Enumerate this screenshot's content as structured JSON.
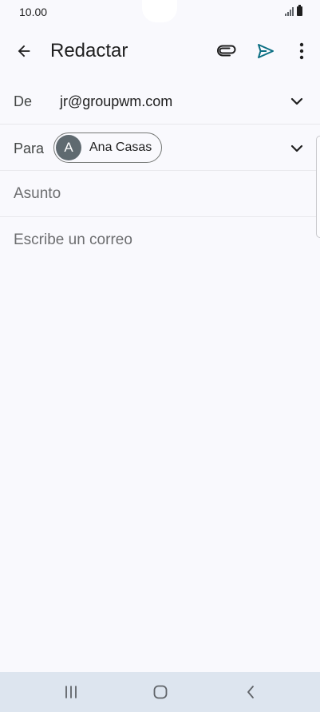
{
  "status_bar": {
    "time": "10.00"
  },
  "app_bar": {
    "title": "Redactar",
    "icons": {
      "back": "arrow-left-icon",
      "attach": "paperclip-icon",
      "send": "send-icon",
      "more": "more-vertical-icon"
    },
    "accent_color": "#0b6f83"
  },
  "form": {
    "from": {
      "label": "De",
      "value": "jr@groupwm.com"
    },
    "to": {
      "label": "Para",
      "recipient": {
        "initial": "A",
        "name": "Ana Casas"
      }
    },
    "subject": {
      "placeholder": "Asunto",
      "value": ""
    },
    "body": {
      "placeholder": "Escribe un correo",
      "value": ""
    }
  },
  "nav_bar": {
    "icons": [
      "recents-icon",
      "home-icon",
      "back-icon"
    ]
  }
}
